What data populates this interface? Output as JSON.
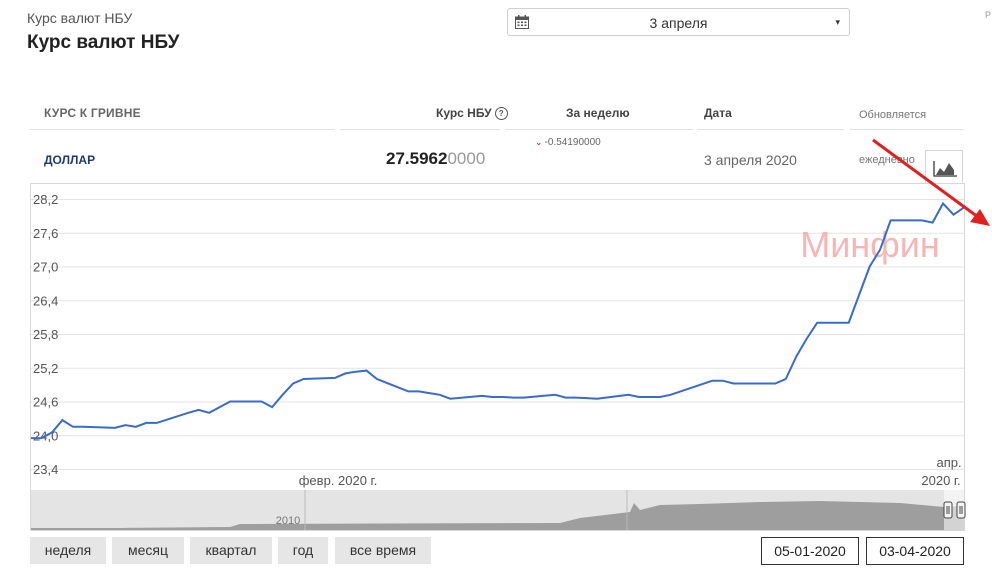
{
  "header": {
    "breadcrumb": "Курс валют НБУ",
    "title": "Курс валют НБУ",
    "edge_mark": "Р"
  },
  "date_picker": {
    "value": "3 апреля",
    "caret": "▾",
    "icon": "calendar-icon"
  },
  "table": {
    "columns": {
      "currency": "КУРС К ГРИВНЕ",
      "rate": "Курс НБУ",
      "week": "За неделю",
      "date": "Дата",
      "updated": "Обновляется"
    },
    "row": {
      "currency": "ДОЛЛАР",
      "rate_main": "27.5962",
      "rate_tail": "0000",
      "change": "-0.54190000",
      "change_arrow": "⌄",
      "date": "3 апреля 2020",
      "frequency": "ежедневно"
    }
  },
  "colors": {
    "line": "#3a6bc9",
    "arrow": "#e02020",
    "watermark": "#f2a4a4",
    "navigator_fill": "#9e9e9e",
    "title_link": "#1e3a6e"
  },
  "watermark": "Минфин",
  "chart_data": {
    "type": "line",
    "x_range": [
      "2020-01-05",
      "2020-04-03"
    ],
    "ylim": [
      23.4,
      28.2
    ],
    "yticks": [
      "28,2",
      "27,6",
      "27,0",
      "26,4",
      "25,8",
      "25,2",
      "24,6",
      "24,0",
      "23,4"
    ],
    "yticks_values": [
      28.2,
      27.6,
      27.0,
      26.4,
      25.8,
      25.2,
      24.6,
      24.0,
      23.4
    ],
    "x_tick_labels": [
      {
        "text": "февр. 2020 г.",
        "date": "2020-02-01"
      },
      {
        "text": "апр.",
        "text2": "2020 г.",
        "date": "2020-04-01"
      }
    ],
    "grid": true,
    "series": [
      {
        "x": [
          "2020-01-05",
          "2020-01-06",
          "2020-01-07",
          "2020-01-08",
          "2020-01-09",
          "2020-01-10",
          "2020-01-13",
          "2020-01-14",
          "2020-01-15",
          "2020-01-16",
          "2020-01-17",
          "2020-01-20",
          "2020-01-21",
          "2020-01-22",
          "2020-01-23",
          "2020-01-24",
          "2020-01-27",
          "2020-01-28",
          "2020-01-29",
          "2020-01-30",
          "2020-01-31",
          "2020-02-03",
          "2020-02-04",
          "2020-02-05",
          "2020-02-06",
          "2020-02-07",
          "2020-02-10",
          "2020-02-11",
          "2020-02-12",
          "2020-02-13",
          "2020-02-14",
          "2020-02-17",
          "2020-02-18",
          "2020-02-19",
          "2020-02-20",
          "2020-02-21",
          "2020-02-24",
          "2020-02-25",
          "2020-02-26",
          "2020-02-27",
          "2020-02-28",
          "2020-03-02",
          "2020-03-03",
          "2020-03-04",
          "2020-03-05",
          "2020-03-06",
          "2020-03-10",
          "2020-03-11",
          "2020-03-12",
          "2020-03-13",
          "2020-03-16",
          "2020-03-17",
          "2020-03-18",
          "2020-03-19",
          "2020-03-20",
          "2020-03-23",
          "2020-03-24",
          "2020-03-25",
          "2020-03-26",
          "2020-03-27",
          "2020-03-30",
          "2020-03-31",
          "2020-04-01",
          "2020-04-02",
          "2020-04-03"
        ],
        "values": [
          23.95,
          23.95,
          24.05,
          24.27,
          24.15,
          24.15,
          24.13,
          24.18,
          24.15,
          24.22,
          24.22,
          24.4,
          24.45,
          24.4,
          24.5,
          24.6,
          24.6,
          24.5,
          24.72,
          24.92,
          25.0,
          25.02,
          25.1,
          25.13,
          25.15,
          25.0,
          24.78,
          24.78,
          24.75,
          24.72,
          24.65,
          24.7,
          24.68,
          24.68,
          24.67,
          24.67,
          24.72,
          24.67,
          24.67,
          24.66,
          24.65,
          24.72,
          24.68,
          24.68,
          24.68,
          24.72,
          24.97,
          24.97,
          24.92,
          24.92,
          24.92,
          25.0,
          25.4,
          25.72,
          26.0,
          26.0,
          26.5,
          27.0,
          27.3,
          27.82,
          27.82,
          27.78,
          28.12,
          27.92,
          28.05
        ]
      }
    ],
    "navigator": {
      "label": "2010"
    }
  },
  "range_buttons": [
    "неделя",
    "месяц",
    "квартал",
    "год",
    "все время"
  ],
  "range_inputs": {
    "from": "05-01-2020",
    "to": "03-04-2020"
  }
}
